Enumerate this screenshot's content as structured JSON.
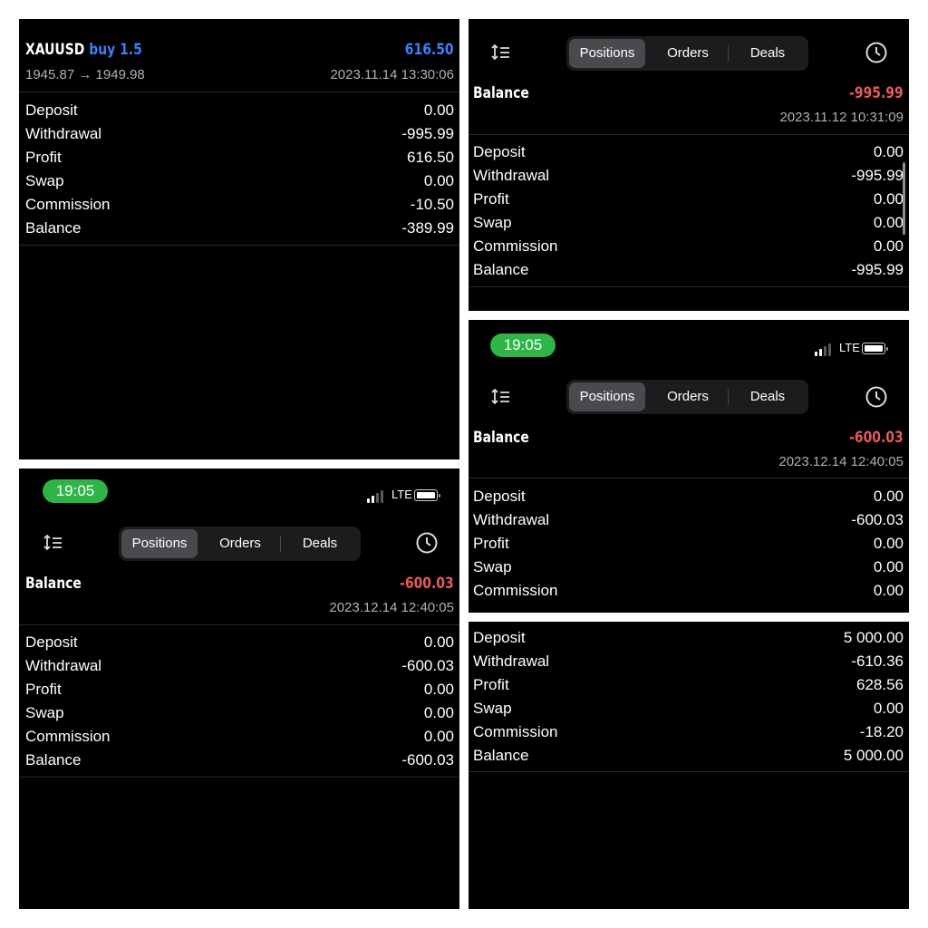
{
  "panel_deal": {
    "symbol": "XAUUSD",
    "direction": "buy 1.5",
    "profit": "616.50",
    "price_path": "1945.87 → 1949.98",
    "timestamp": "2023.11.14 13:30:06",
    "rows": [
      {
        "label": "Deposit",
        "value": "0.00"
      },
      {
        "label": "Withdrawal",
        "value": "-995.99"
      },
      {
        "label": "Profit",
        "value": "616.50"
      },
      {
        "label": "Swap",
        "value": "0.00"
      },
      {
        "label": "Commission",
        "value": "-10.50"
      },
      {
        "label": "Balance",
        "value": "-389.99"
      }
    ]
  },
  "panel_balance_nov": {
    "tabs": [
      "Positions",
      "Orders",
      "Deals"
    ],
    "active_tab": "Positions",
    "heading": "Balance",
    "amount": "-995.99",
    "timestamp": "2023.11.12 10:31:09",
    "rows": [
      {
        "label": "Deposit",
        "value": "0.00"
      },
      {
        "label": "Withdrawal",
        "value": "-995.99"
      },
      {
        "label": "Profit",
        "value": "0.00"
      },
      {
        "label": "Swap",
        "value": "0.00"
      },
      {
        "label": "Commission",
        "value": "0.00"
      },
      {
        "label": "Balance",
        "value": "-995.99"
      }
    ]
  },
  "panel_balance_dec_right": {
    "clock": "19:05",
    "network": "LTE",
    "tabs": [
      "Positions",
      "Orders",
      "Deals"
    ],
    "active_tab": "Positions",
    "heading": "Balance",
    "amount": "-600.03",
    "timestamp": "2023.12.14 12:40:05",
    "rows": [
      {
        "label": "Deposit",
        "value": "0.00"
      },
      {
        "label": "Withdrawal",
        "value": "-600.03"
      },
      {
        "label": "Profit",
        "value": "0.00"
      },
      {
        "label": "Swap",
        "value": "0.00"
      },
      {
        "label": "Commission",
        "value": "0.00"
      }
    ]
  },
  "panel_balance_dec_left": {
    "clock": "19:05",
    "network": "LTE",
    "tabs": [
      "Positions",
      "Orders",
      "Deals"
    ],
    "active_tab": "Positions",
    "heading": "Balance",
    "amount": "-600.03",
    "timestamp": "2023.12.14 12:40:05",
    "rows": [
      {
        "label": "Deposit",
        "value": "0.00"
      },
      {
        "label": "Withdrawal",
        "value": "-600.03"
      },
      {
        "label": "Profit",
        "value": "0.00"
      },
      {
        "label": "Swap",
        "value": "0.00"
      },
      {
        "label": "Commission",
        "value": "0.00"
      },
      {
        "label": "Balance",
        "value": "-600.03"
      }
    ]
  },
  "panel_summary": {
    "rows": [
      {
        "label": "Deposit",
        "value": "5 000.00"
      },
      {
        "label": "Withdrawal",
        "value": "-610.36"
      },
      {
        "label": "Profit",
        "value": "628.56"
      },
      {
        "label": "Swap",
        "value": "0.00"
      },
      {
        "label": "Commission",
        "value": "-18.20"
      },
      {
        "label": "Balance",
        "value": "5 000.00"
      }
    ]
  },
  "colors": {
    "accent_blue": "#3a82f7",
    "negative_red": "#e35b5b",
    "clock_green": "#2fb547"
  },
  "icons": {
    "sort": "sort-icon",
    "history": "clock-history-icon",
    "signal": "signal-bars-icon",
    "battery": "battery-icon"
  }
}
